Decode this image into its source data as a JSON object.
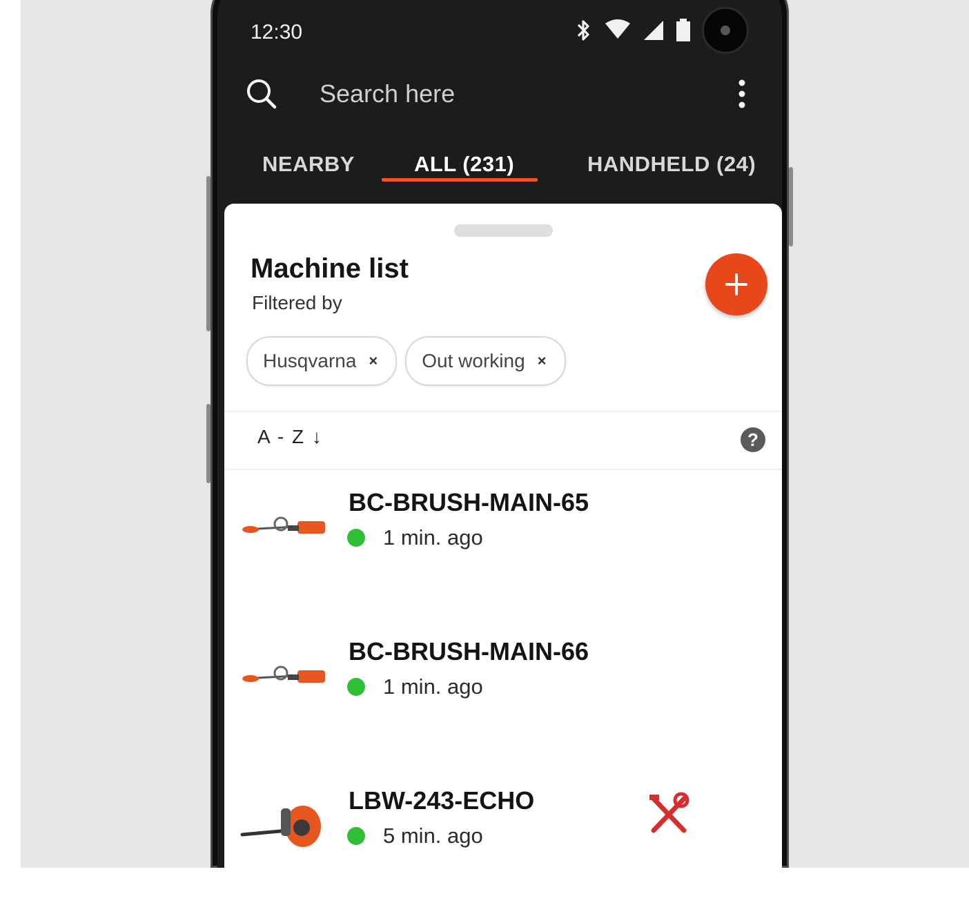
{
  "status_bar": {
    "time": "12:30",
    "icons": [
      "bluetooth-icon",
      "wifi-icon",
      "signal-icon",
      "battery-icon",
      "camera-icon"
    ]
  },
  "search": {
    "placeholder": "Search here",
    "icon": "search-icon",
    "menu_icon": "more-vert-icon"
  },
  "tabs": [
    {
      "label": "NEARBY",
      "active": false
    },
    {
      "label": "ALL (231)",
      "active": true
    },
    {
      "label": "HANDHELD (24)",
      "active": false
    }
  ],
  "sheet": {
    "title": "Machine list",
    "subtitle": "Filtered by",
    "add_button_icon": "plus-icon",
    "filters": [
      {
        "label": "Husqvarna",
        "remove": "×"
      },
      {
        "label": "Out working",
        "remove": "×"
      }
    ],
    "sort_label": "A - Z ↓",
    "help_label": "?"
  },
  "machines": [
    {
      "name": "BC-BRUSH-MAIN-65",
      "status": "1 min. ago",
      "icon": "brushcutter-icon",
      "service": false
    },
    {
      "name": "BC-BRUSH-MAIN-66",
      "status": "1 min. ago",
      "icon": "brushcutter-icon",
      "service": false
    },
    {
      "name": "LBW-243-ECHO",
      "status": "5 min. ago",
      "icon": "leaf-blower-icon",
      "service": true
    }
  ],
  "colors": {
    "accent": "#e8461b",
    "tab_indicator": "#f35325",
    "online": "#2fbf37",
    "service": "#d62d2d",
    "header_bg": "#1c1c1c"
  }
}
